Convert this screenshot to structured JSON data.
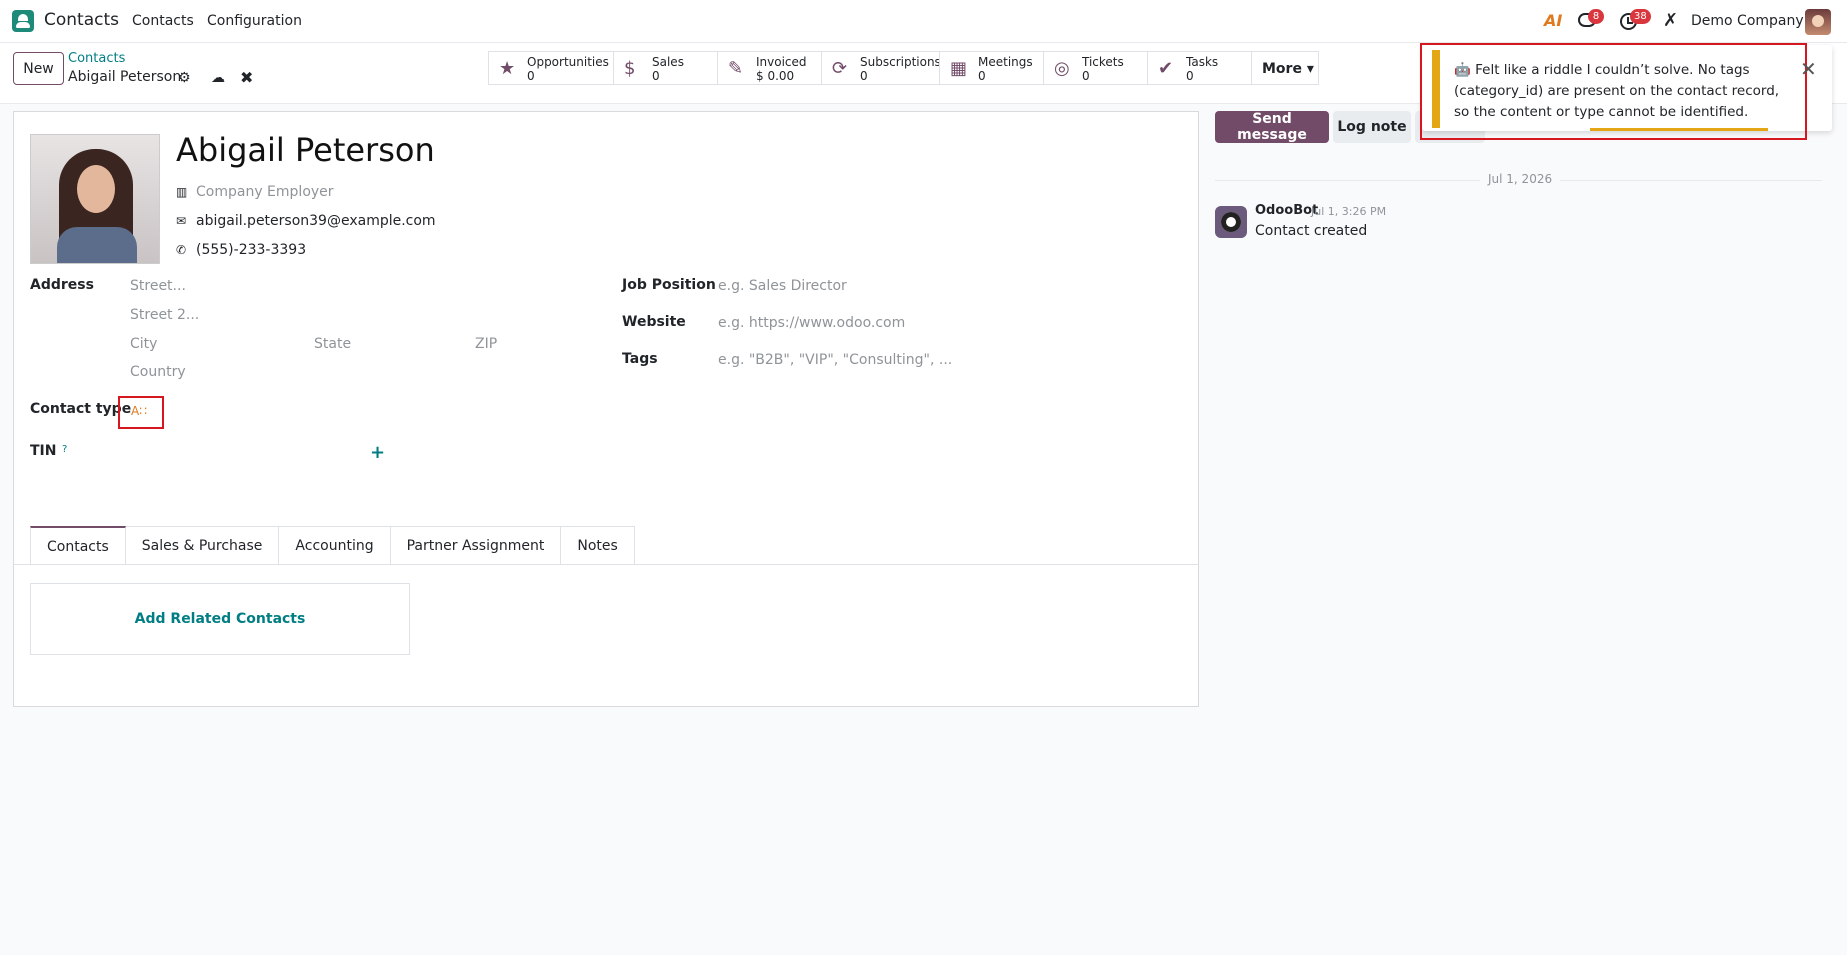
{
  "topnav": {
    "app_name": "Contacts",
    "menu": [
      "Contacts",
      "Configuration"
    ],
    "ai_label": "AI",
    "messages_count": "8",
    "activities_count": "38",
    "company": "Demo Company"
  },
  "control": {
    "new_label": "New",
    "breadcrumb_parent": "Contacts",
    "breadcrumb_current": "Abigail Peterson",
    "smart_buttons": [
      {
        "label": "Opportunities",
        "value": "0",
        "icon": "star-icon"
      },
      {
        "label": "Sales",
        "value": "0",
        "icon": "dollar-icon"
      },
      {
        "label": "Invoiced",
        "value": "$ 0.00",
        "icon": "invoice-icon"
      },
      {
        "label": "Subscriptions",
        "value": "0",
        "icon": "refresh-icon"
      },
      {
        "label": "Meetings",
        "value": "0",
        "icon": "calendar-icon"
      },
      {
        "label": "Tickets",
        "value": "0",
        "icon": "lifebuoy-icon"
      },
      {
        "label": "Tasks",
        "value": "0",
        "icon": "check-icon"
      }
    ],
    "more_label": "More"
  },
  "form": {
    "name": "Abigail Peterson",
    "company_placeholder": "Company Employer",
    "email": "abigail.peterson39@example.com",
    "phone": "(555)-233-3393",
    "address_label": "Address",
    "street_placeholder": "Street...",
    "street2_placeholder": "Street 2...",
    "city_placeholder": "City",
    "state_placeholder": "State",
    "zip_placeholder": "ZIP",
    "country_placeholder": "Country",
    "contact_type_label": "Contact type",
    "contact_type_icon": "A∷",
    "tin_label": "TIN",
    "tin_help": "?",
    "job_position_label": "Job Position",
    "job_position_placeholder": "e.g. Sales Director",
    "website_label": "Website",
    "website_placeholder": "e.g. https://www.odoo.com",
    "tags_label": "Tags",
    "tags_placeholder": "e.g. \"B2B\", \"VIP\", \"Consulting\", ...",
    "tabs": [
      "Contacts",
      "Sales & Purchase",
      "Accounting",
      "Partner Assignment",
      "Notes"
    ],
    "add_related": "Add Related Contacts"
  },
  "chatter": {
    "send_message": "Send message",
    "log_note": "Log note",
    "date_separator": "Jul 1, 2026",
    "author": "OdooBot",
    "message_date": "Jul 1, 3:26 PM",
    "message_body": "Contact created"
  },
  "notification": {
    "emoji": "🤖",
    "text": "Felt like a riddle I couldn’t solve. No tags (category_id) are present on the contact record, so the content or type cannot be identified.",
    "accent": "#e5a616"
  },
  "colors": {
    "brand": "#714b67",
    "link": "#017e84",
    "highlight": "#d7171f"
  }
}
